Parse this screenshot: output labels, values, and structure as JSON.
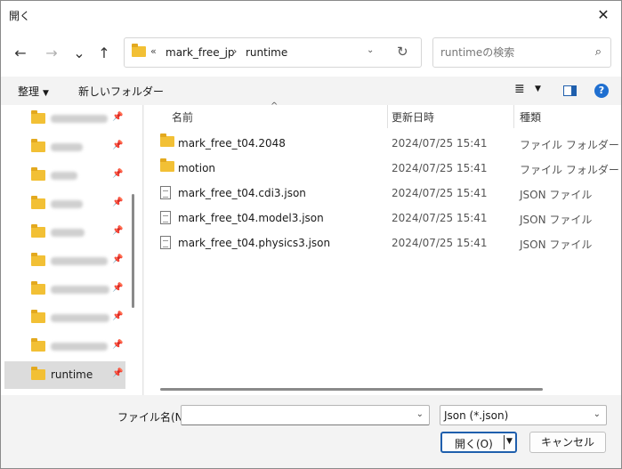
{
  "window": {
    "title": "開く",
    "close_glyph": "✕"
  },
  "nav": {
    "back": "←",
    "forward": "→",
    "recent": "⌄",
    "up": "↑",
    "address": {
      "chevron": "«",
      "crumbs": [
        "mark_free_jp",
        "runtime"
      ],
      "separator": "›",
      "dropdown": "⌄",
      "refresh": "↻"
    },
    "search": {
      "placeholder": "runtimeの検索",
      "icon": "⌕"
    }
  },
  "toolbar": {
    "organize": "整理",
    "organize_caret": "▼",
    "new_folder": "新しいフォルダー",
    "view_glyph": "≣",
    "view_caret": "▼",
    "help": "?"
  },
  "sidebar": {
    "items": [
      {
        "label": "",
        "blurred": true,
        "pinned": true
      },
      {
        "label": "",
        "blurred": true,
        "pinned": true
      },
      {
        "label": "",
        "blurred": true,
        "pinned": true
      },
      {
        "label": "",
        "blurred": true,
        "pinned": true
      },
      {
        "label": "",
        "blurred": true,
        "pinned": true
      },
      {
        "label": "",
        "blurred": true,
        "pinned": true
      },
      {
        "label": "",
        "blurred": true,
        "pinned": true
      },
      {
        "label": "",
        "blurred": true,
        "pinned": true
      },
      {
        "label": "",
        "blurred": true,
        "pinned": true
      },
      {
        "label": "runtime",
        "blurred": false,
        "pinned": true,
        "selected": true
      }
    ],
    "pin_glyph": "📌"
  },
  "list": {
    "columns": {
      "name": "名前",
      "date": "更新日時",
      "type": "種類"
    },
    "sort_arrow": "^",
    "rows": [
      {
        "icon": "folder",
        "name": "mark_free_t04.2048",
        "date": "2024/07/25 15:41",
        "type": "ファイル フォルダー"
      },
      {
        "icon": "folder",
        "name": "motion",
        "date": "2024/07/25 15:41",
        "type": "ファイル フォルダー"
      },
      {
        "icon": "file",
        "name": "mark_free_t04.cdi3.json",
        "date": "2024/07/25 15:41",
        "type": "JSON ファイル"
      },
      {
        "icon": "file",
        "name": "mark_free_t04.model3.json",
        "date": "2024/07/25 15:41",
        "type": "JSON ファイル"
      },
      {
        "icon": "file",
        "name": "mark_free_t04.physics3.json",
        "date": "2024/07/25 15:41",
        "type": "JSON ファイル"
      }
    ]
  },
  "bottom": {
    "filename_label": "ファイル名(N):",
    "filename_value": "",
    "filetype_value": "Json (*.json)",
    "dd_glyph": "⌄",
    "open_label": "開く(O)",
    "open_arrow": "▼",
    "cancel_label": "キャンセル"
  }
}
